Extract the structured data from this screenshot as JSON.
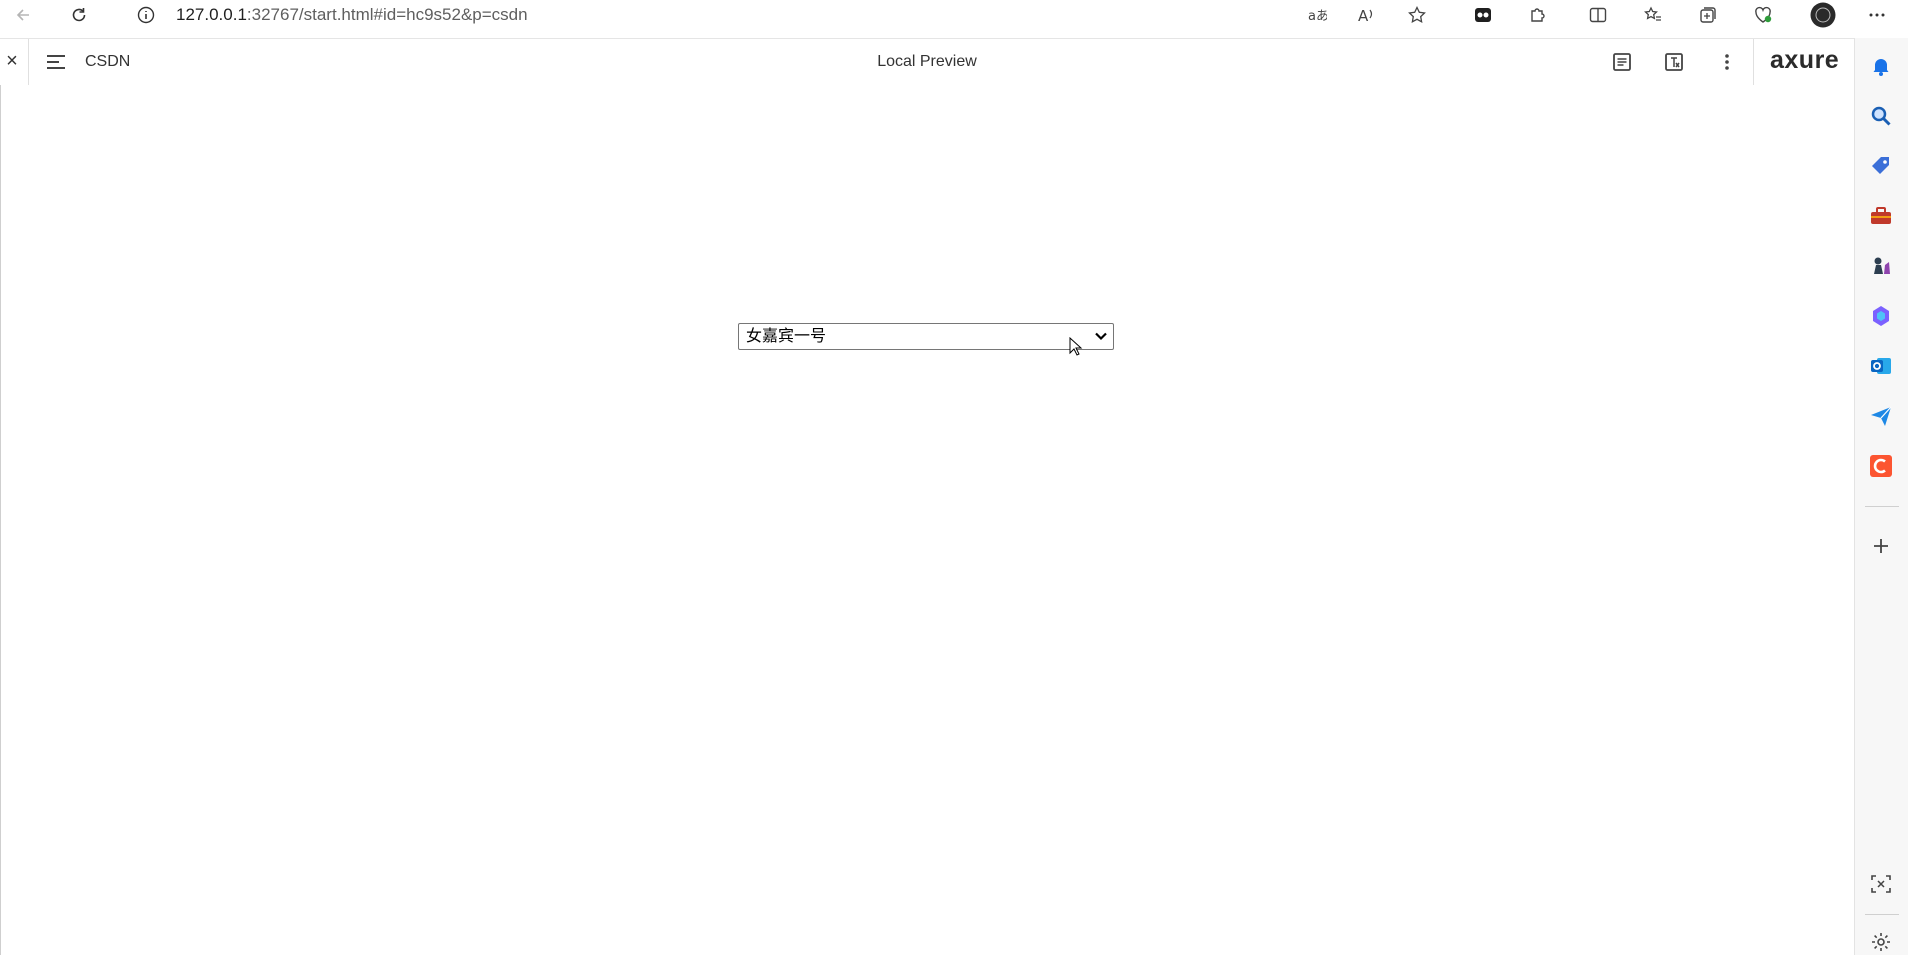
{
  "browser": {
    "url_host": "127.0.0.1",
    "url_rest": ":32767/start.html#id=hc9s52&p=csdn"
  },
  "toolbar": {
    "close_label": "×",
    "project_name": "CSDN",
    "center_title": "Local Preview",
    "logo_text": "axure"
  },
  "content": {
    "dropdown": {
      "selected_value": "女嘉宾一号"
    }
  },
  "sidebar": {
    "items": [
      {
        "icon": "bell-icon",
        "color": "#1a73e8"
      },
      {
        "icon": "search-icon",
        "color": "#1a5fb4"
      },
      {
        "icon": "tag-icon",
        "color": "#3b6fd8"
      },
      {
        "icon": "toolbox-icon",
        "color": "#c0392b"
      },
      {
        "icon": "chess-icon",
        "color": "#5b4bc4"
      },
      {
        "icon": "copilot-icon",
        "color": "#7b61ff"
      },
      {
        "icon": "outlook-icon",
        "color": "#0a66c2"
      },
      {
        "icon": "send-icon",
        "color": "#1e88e5"
      },
      {
        "icon": "csdn-icon",
        "color": "#fc5531"
      }
    ]
  },
  "colors": {
    "accent_csdn": "#fc5531",
    "border": "#767676"
  }
}
